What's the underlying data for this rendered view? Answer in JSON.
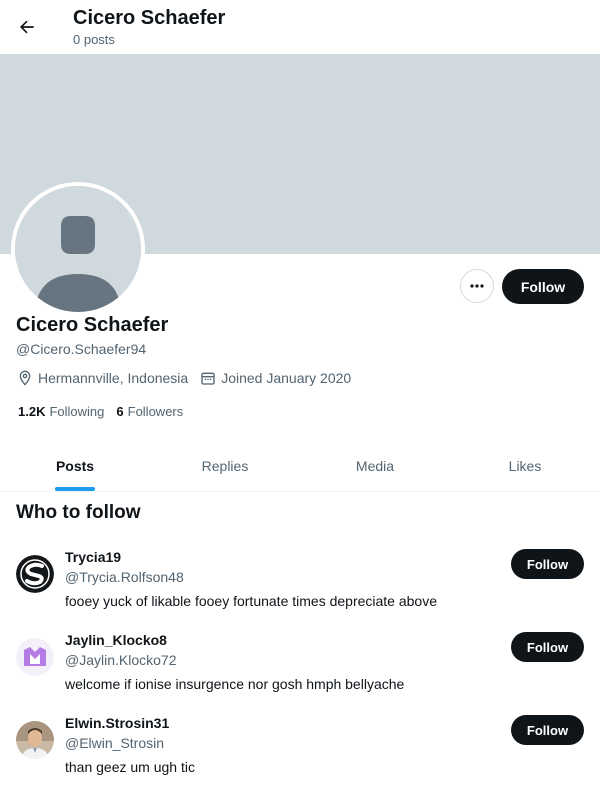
{
  "header": {
    "title": "Cicero Schaefer",
    "subtitle": "0 posts"
  },
  "profile": {
    "name": "Cicero Schaefer",
    "handle": "@Cicero.Schaefer94",
    "location": "Hermannville, Indonesia",
    "joined": "Joined January 2020",
    "following_count": "1.2K",
    "following_label": "Following",
    "followers_count": "6",
    "followers_label": "Followers",
    "follow_label": "Follow",
    "more_label": "•••"
  },
  "tabs": [
    {
      "label": "Posts",
      "active": true
    },
    {
      "label": "Replies",
      "active": false
    },
    {
      "label": "Media",
      "active": false
    },
    {
      "label": "Likes",
      "active": false
    }
  ],
  "who_to_follow": {
    "title": "Who to follow",
    "items": [
      {
        "name": "Trycia19",
        "handle": "@Trycia.Rolfson48",
        "bio": "fooey yuck of likable fooey fortunate times depreciate above",
        "button": "Follow",
        "avatar_icon": "s-logo-avatar"
      },
      {
        "name": "Jaylin_Klocko8",
        "handle": "@Jaylin.Klocko72",
        "bio": "welcome if ionise insurgence nor gosh hmph bellyache",
        "button": "Follow",
        "avatar_icon": "purple-m-avatar"
      },
      {
        "name": "Elwin.Strosin31",
        "handle": "@Elwin_Strosin",
        "bio": "than geez um ugh tic",
        "button": "Follow",
        "avatar_icon": "photo-avatar"
      }
    ]
  },
  "colors": {
    "accent": "#1d9bf0",
    "banner": "#cfd9de",
    "button": "#0f1419",
    "muted": "#536471"
  }
}
